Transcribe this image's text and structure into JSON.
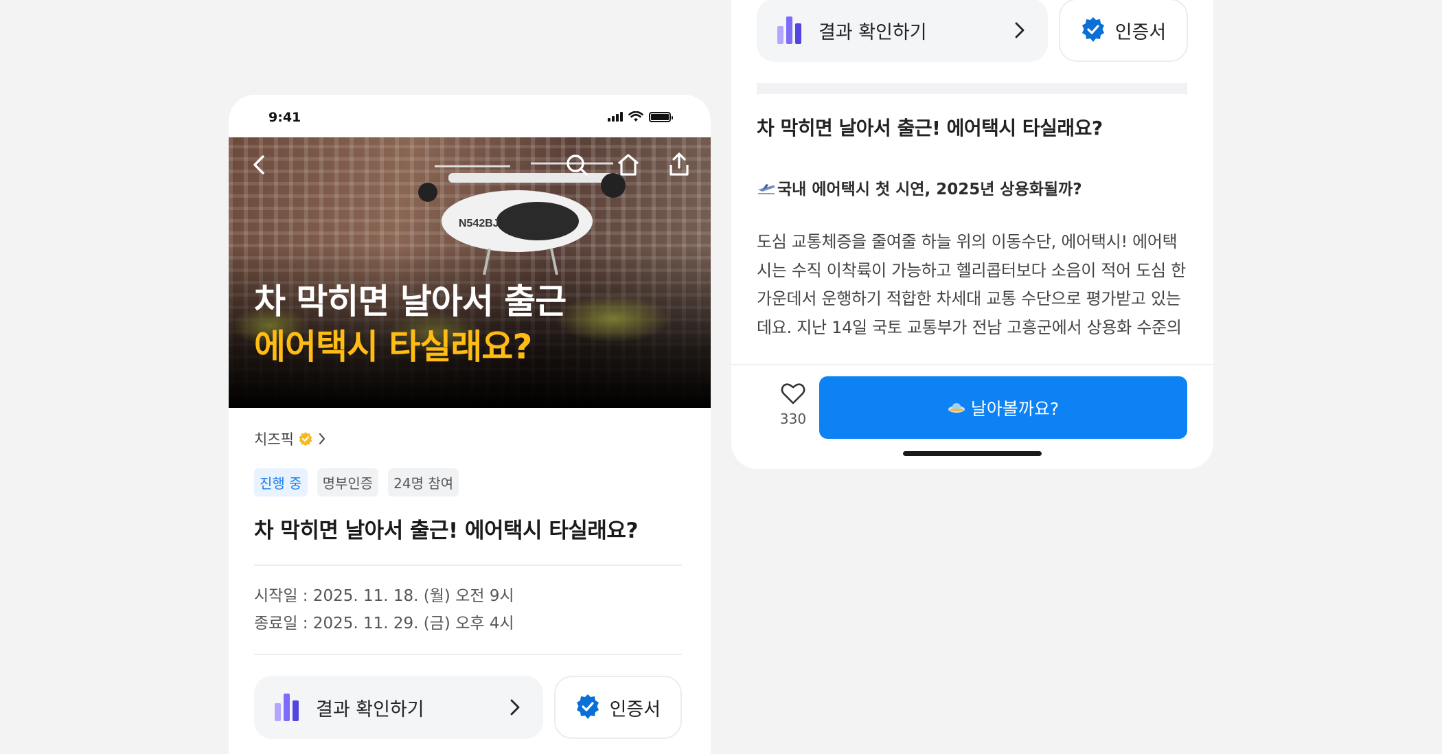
{
  "status_bar": {
    "time": "9:41"
  },
  "hero": {
    "title_line1": "차 막히면 날아서 출근",
    "title_line2": "에어택시 타실래요?",
    "accent_color": "#ffbd14"
  },
  "nav_icons": [
    "back-icon",
    "search-icon",
    "home-icon",
    "share-icon"
  ],
  "channel": {
    "name": "치즈픽",
    "verified": true
  },
  "tags": [
    "진행 중",
    "명부인증",
    "24명 참여"
  ],
  "post": {
    "title": "차 막히면 날아서 출근! 에어택시 타실래요?",
    "start_date": "시작일 : 2025. 11. 18. (월) 오전 9시",
    "end_date": "종료일 : 2025. 11. 29. (금) 오후 4시"
  },
  "actions": {
    "result_label": "결과 확인하기",
    "certificate_label": "인증서"
  },
  "detail": {
    "title": "차 막히면 날아서 출근! 에어택시 타실래요?",
    "subtitle": "국내 에어택시 첫 시연, 2025년 상용화될까?",
    "body": "도심 교통체증을 줄여줄 하늘 위의 이동수단, 에어택시! 에어택시는 수직 이착륙이 가능하고 헬리콥터보다 소음이 적어 도심 한 가운데서 운행하기 적합한 차세대 교통 수단으로 평가받고 있는데요. 지난 14일 국토 교통부가 전남 고흥군에서 상용화 수준의 에어택시를 시연 비행했어요. 시연에 투입된 기"
  },
  "footer": {
    "like_count": "330",
    "cta_label": "날아볼까요?",
    "cta_color": "#0c82f5"
  }
}
